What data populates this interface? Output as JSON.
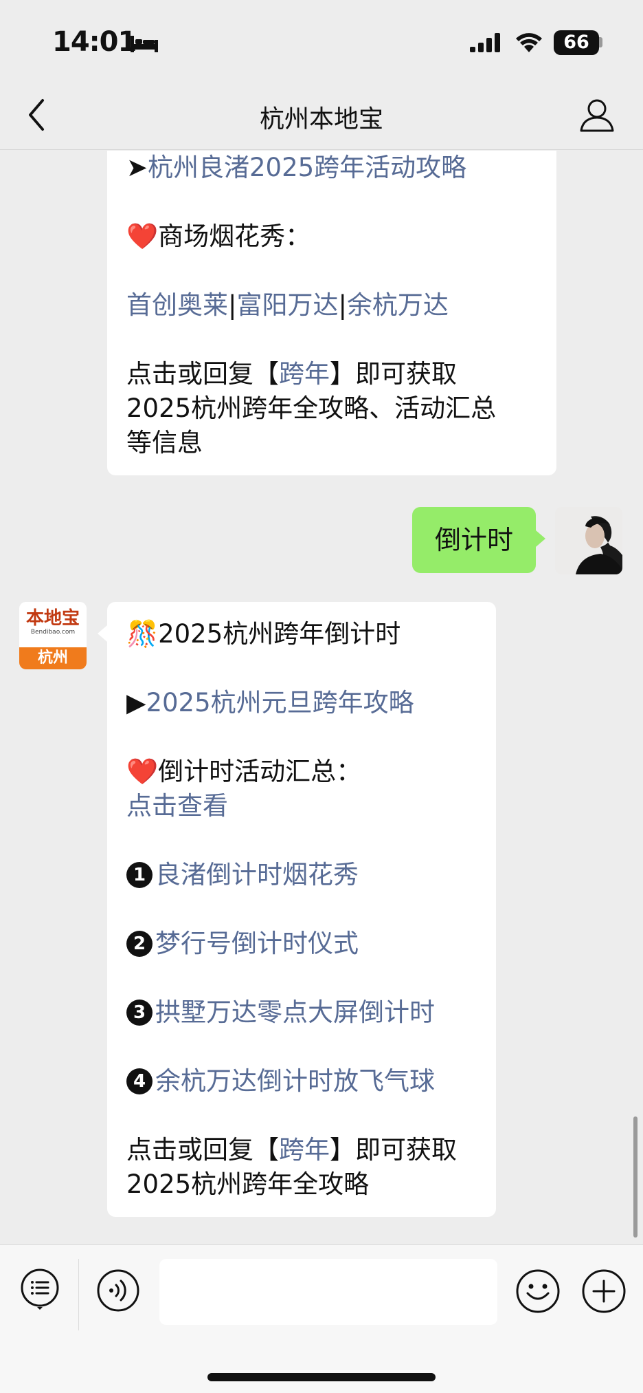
{
  "status_bar": {
    "time": "14:01",
    "battery": "66"
  },
  "nav": {
    "title": "杭州本地宝"
  },
  "messages": {
    "bot_1": {
      "link_liangzhu_prefix": "➤",
      "link_liangzhu": "杭州良渚2025跨年活动攻略",
      "heart_icon": "❤️",
      "mall_fireworks_label": "商场烟花秀：",
      "mall_link_1": "首创奥莱",
      "mall_sep_1": "|",
      "mall_link_2": "富阳万达",
      "mall_sep_2": "|",
      "mall_link_3": "余杭万达",
      "reply_prefix": "点击或回复【",
      "reply_keyword": "跨年",
      "reply_suffix": "】即可获取",
      "reply_line_2": "2025杭州跨年全攻略、活动汇总",
      "reply_line_3": "等信息"
    },
    "user_1": {
      "text": "倒计时"
    },
    "bot_2": {
      "avatar_logo": "本地宝",
      "avatar_logo_sub": "Bendibao.com",
      "avatar_city": "杭州",
      "title_icon": "🎊",
      "title": "2025杭州跨年倒计时",
      "link_prefix": "▶",
      "link_guide": "2025杭州元旦跨年攻略",
      "heart_icon": "❤️",
      "countdown_label": "倒计时活动汇总：",
      "view_link": "点击查看",
      "items": [
        {
          "num": "1",
          "label": "良渚倒计时烟花秀"
        },
        {
          "num": "2",
          "label": "梦行号倒计时仪式"
        },
        {
          "num": "3",
          "label": "拱墅万达零点大屏倒计时"
        },
        {
          "num": "4",
          "label": "余杭万达倒计时放飞气球"
        }
      ],
      "reply_prefix": "点击或回复【",
      "reply_keyword": "跨年",
      "reply_suffix": "】即可获取",
      "reply_line_2": "2025杭州跨年全攻略"
    }
  },
  "input_bar": {
    "placeholder": ""
  },
  "colors": {
    "link": "#576b95",
    "user_bubble": "#95ec69",
    "avatar_orange": "#f07b1c"
  }
}
